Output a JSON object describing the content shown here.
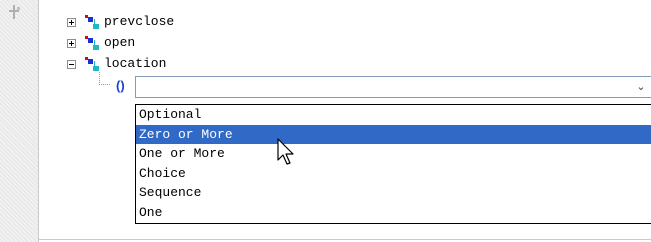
{
  "tree": {
    "nodes": [
      {
        "label": "prevclose",
        "state": "collapsed"
      },
      {
        "label": "open",
        "state": "collapsed"
      },
      {
        "label": "location",
        "state": "expanded"
      }
    ],
    "compositor_symbol": "()"
  },
  "combo": {
    "value": "",
    "arrow_glyph": "⌄"
  },
  "dropdown": {
    "options": [
      "Optional",
      "Zero or More",
      "One or More",
      "Choice",
      "Sequence",
      "One"
    ],
    "selected": "Zero or More"
  },
  "colors": {
    "selection": "#3169c6",
    "compositor": "#1f3fcf",
    "element_icon_red": "#cc1010",
    "element_icon_blue": "#1c2fd0",
    "element_icon_cyan": "#20b8c8"
  }
}
